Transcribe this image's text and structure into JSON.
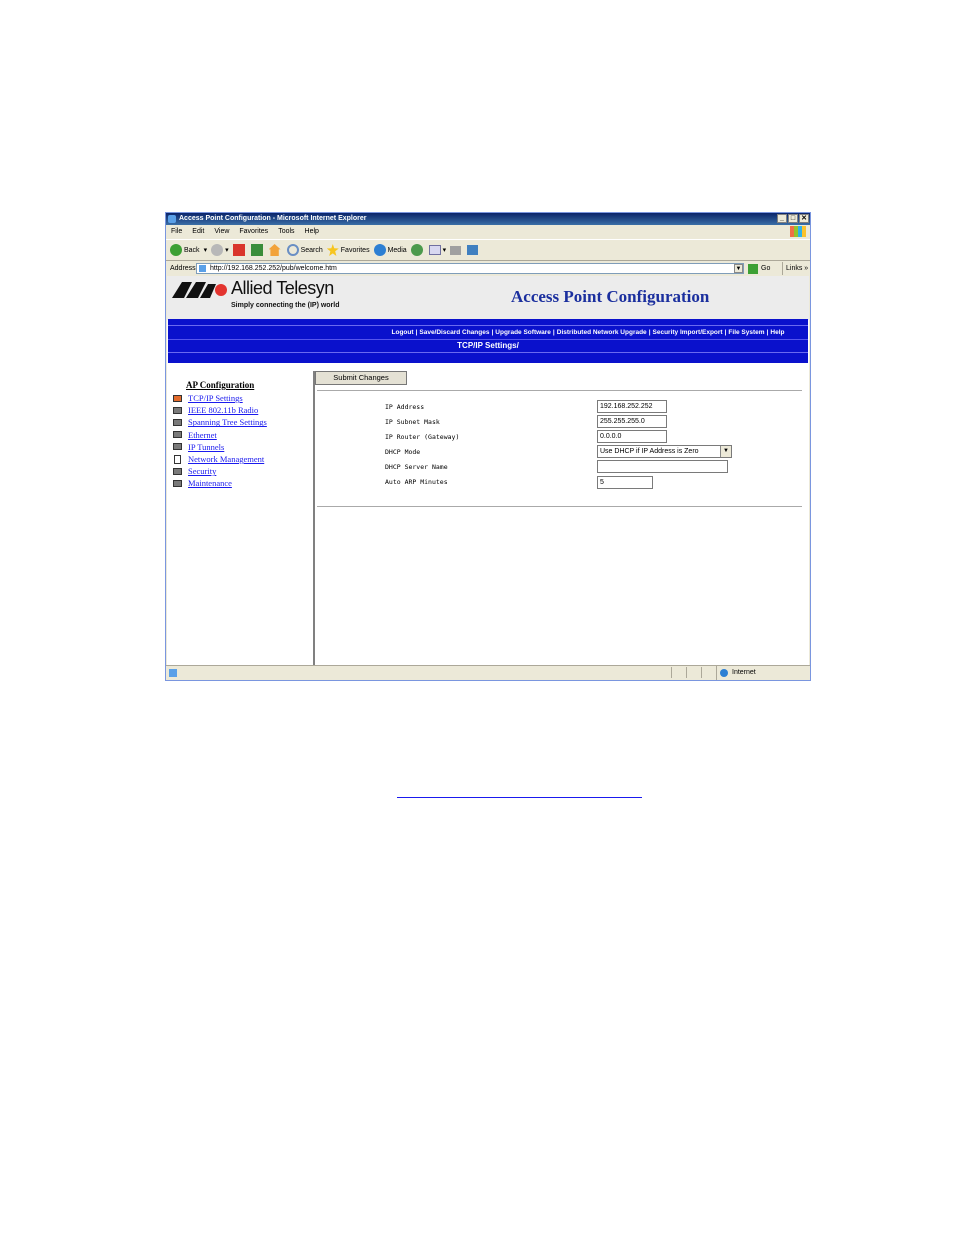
{
  "window": {
    "title": "Access Point Configuration - Microsoft Internet Explorer",
    "buttons": [
      "_",
      "□",
      "✕"
    ]
  },
  "menu": [
    "File",
    "Edit",
    "View",
    "Favorites",
    "Tools",
    "Help"
  ],
  "toolbar": {
    "back": "Back",
    "search": "Search",
    "favorites": "Favorites",
    "media": "Media"
  },
  "address": {
    "label": "Address",
    "url": "http://192.168.252.252/pub/welcome.htm",
    "go": "Go",
    "links": "Links »"
  },
  "brand": {
    "name": "Allied Telesyn",
    "tagline": "Simply connecting the (IP) world",
    "app_title": "Access Point Configuration"
  },
  "nav": {
    "links": [
      "Logout",
      "Save/Discard Changes",
      "Upgrade Software",
      "Distributed Network Upgrade",
      "Security Import/Export",
      "File System",
      "Help"
    ],
    "breadcrumb": "TCP/IP Settings/"
  },
  "sidebar": {
    "title": "AP Configuration",
    "items": [
      {
        "label": "TCP/IP Settings"
      },
      {
        "label": "IEEE 802.11b Radio"
      },
      {
        "label": "Spanning Tree Settings"
      },
      {
        "label": "Ethernet"
      },
      {
        "label": "IP Tunnels"
      },
      {
        "label": "Network Management"
      },
      {
        "label": "Security"
      },
      {
        "label": "Maintenance"
      }
    ]
  },
  "form": {
    "submit_label": "Submit Changes",
    "fields": [
      {
        "label": "IP Address",
        "value": "192.168.252.252"
      },
      {
        "label": "IP Subnet Mask",
        "value": "255.255.255.0"
      },
      {
        "label": "IP Router (Gateway)",
        "value": "0.0.0.0"
      },
      {
        "label": "DHCP Mode",
        "value": "Use DHCP if IP Address is Zero"
      },
      {
        "label": "DHCP Server Name",
        "value": ""
      },
      {
        "label": "Auto ARP Minutes",
        "value": "5"
      }
    ]
  },
  "status": {
    "zone": "Internet"
  },
  "colors": {
    "nav_blue": "#0a11cc",
    "title_blue": "#1b2f9e",
    "link_blue": "#1a1aee",
    "logo_red": "#e3342f"
  }
}
